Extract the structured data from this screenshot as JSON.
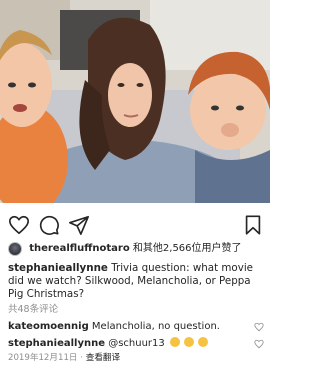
{
  "photo": {
    "icon": "family-selfie-photo"
  },
  "actions": {
    "like_icon": "heart-icon",
    "comment_icon": "comment-icon",
    "share_icon": "send-icon",
    "save_icon": "bookmark-icon"
  },
  "likes": {
    "username": "therealfluffnotaro",
    "text": "和其他2,566位用户赞了"
  },
  "caption": {
    "username": "stephanieallynne",
    "text": "Trivia question: what movie did we watch? Silkwood, Melancholia, or Peppa Pig Christmas?"
  },
  "view_all": "共48条评论",
  "comments": [
    {
      "username": "kateomoennig",
      "text": "Melancholia, no question."
    },
    {
      "username": "stephanieallynne",
      "text": "@schuur13",
      "emoji": "clapping-hands"
    }
  ],
  "date": "2019年12月11日",
  "separator": "·",
  "translate": "查看翻译"
}
